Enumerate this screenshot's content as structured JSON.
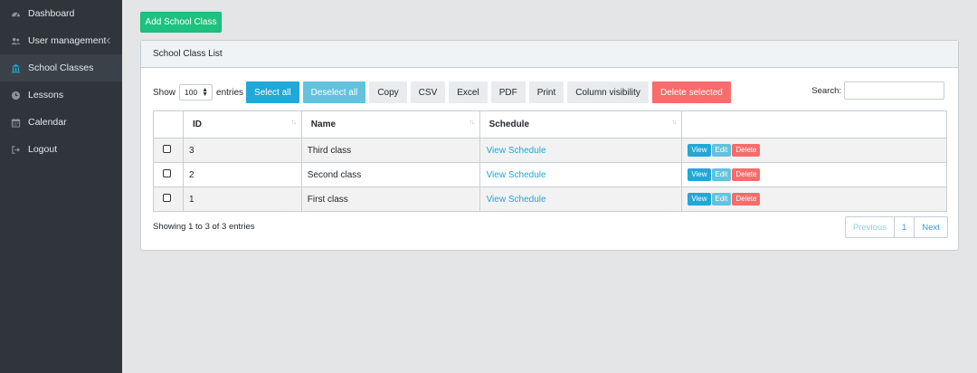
{
  "sidebar": {
    "items": [
      {
        "label": "Dashboard",
        "icon": "dashboard-icon"
      },
      {
        "label": "User management",
        "icon": "users-icon",
        "has_chevron": true
      },
      {
        "label": "School Classes",
        "icon": "bank-icon",
        "active": true
      },
      {
        "label": "Lessons",
        "icon": "clock-icon"
      },
      {
        "label": "Calendar",
        "icon": "calendar-icon"
      },
      {
        "label": "Logout",
        "icon": "logout-icon"
      }
    ]
  },
  "main": {
    "add_button": "Add School Class",
    "card_title": "School Class List",
    "toolbar": {
      "show_label": "Show",
      "entries_value": "100",
      "entries_label": "entries",
      "buttons": [
        "Select all",
        "Deselect all",
        "Copy",
        "CSV",
        "Excel",
        "PDF",
        "Print",
        "Column visibility",
        "Delete selected"
      ],
      "search_label": "Search:"
    },
    "table": {
      "columns": [
        "ID",
        "Name",
        "Schedule"
      ],
      "rows": [
        {
          "id": "3",
          "name": "Third class",
          "schedule": "View Schedule"
        },
        {
          "id": "2",
          "name": "Second class",
          "schedule": "View Schedule"
        },
        {
          "id": "1",
          "name": "First class",
          "schedule": "View Schedule"
        }
      ],
      "actions": [
        "View",
        "Edit",
        "Delete"
      ]
    },
    "info": "Showing 1 to 3 of 3 entries",
    "pagination": {
      "previous": "Previous",
      "page": "1",
      "next": "Next"
    }
  },
  "colors": {
    "sidebar_bg": "#2f353a",
    "accent_green": "#1fc180",
    "info": "#20a8d8",
    "info_light": "#63c2de",
    "danger": "#f86c6b"
  }
}
